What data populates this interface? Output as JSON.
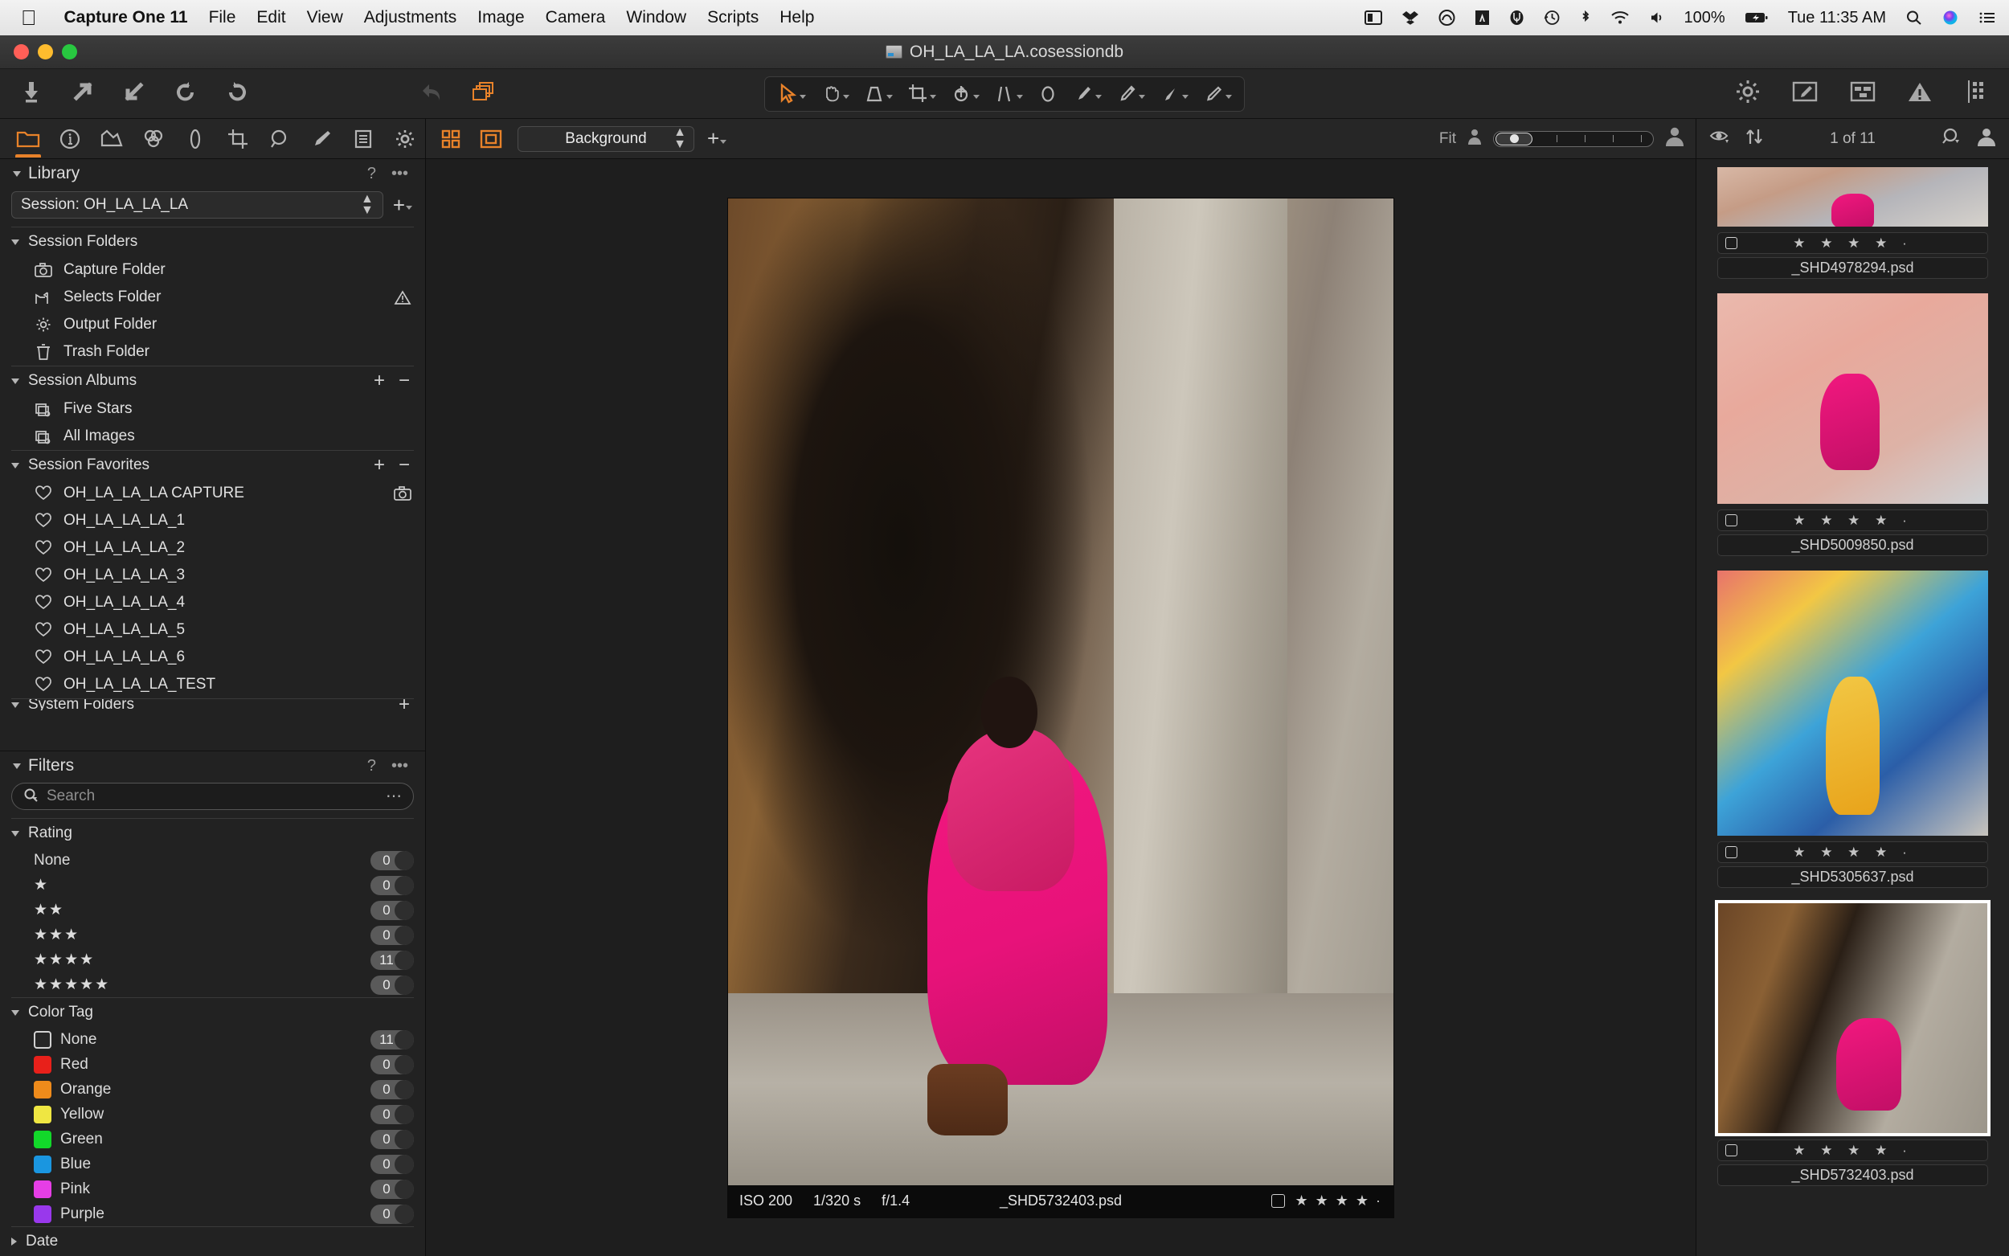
{
  "menubar": {
    "apple": "",
    "app_name": "Capture One 11",
    "items": [
      "File",
      "Edit",
      "View",
      "Adjustments",
      "Image",
      "Camera",
      "Window",
      "Scripts",
      "Help"
    ],
    "status": {
      "icons": [
        "display-icon",
        "dropbox-icon",
        "creative-cloud-icon",
        "adobe-icon",
        "app-icon",
        "time-machine-icon",
        "bluetooth-icon",
        "wifi-icon",
        "volume-icon"
      ],
      "battery_percent": "100%",
      "battery_icon": "battery-charging-icon",
      "clock": "Tue 11:35 AM",
      "spotlight_icon": "search-icon",
      "siri_icon": "siri-icon",
      "notification_icon": "notification-center-icon"
    }
  },
  "window": {
    "title": "OH_LA_LA_LA.cosessiondb",
    "traffic_lights": [
      "close",
      "minimize",
      "zoom"
    ]
  },
  "toolbar": {
    "left_tools": [
      "import-images-icon",
      "export-arrow-icon",
      "import-arrow-icon",
      "rotate-left-icon",
      "rotate-right-icon"
    ],
    "undo_icon": "undo-icon",
    "copy_apply_icon": "copy-apply-adjustments-icon",
    "center_tools": [
      "select-cursor-icon",
      "pan-hand-icon",
      "keystone-icon",
      "crop-icon",
      "rotate-icon",
      "straighten-lines-icon",
      "spot-removal-icon",
      "draw-mask-brush-icon",
      "eyedropper-icon",
      "gradient-mask-icon",
      "heal-brush-icon"
    ],
    "right_tools": [
      "gear-icon",
      "edit-pencil-icon",
      "layout-icon",
      "warning-icon",
      "grid-icon"
    ]
  },
  "tool_tabs": [
    {
      "name": "library-tab",
      "icon": "folder-icon",
      "active": true
    },
    {
      "name": "info-tab",
      "icon": "info-icon",
      "active": false
    },
    {
      "name": "lens-tab",
      "icon": "lens-correction-icon",
      "active": false
    },
    {
      "name": "color-tab",
      "icon": "color-circles-icon",
      "active": false
    },
    {
      "name": "exposure-tab",
      "icon": "exposure-icon",
      "active": false
    },
    {
      "name": "composition-tab",
      "icon": "crop-icon",
      "active": false
    },
    {
      "name": "details-tab",
      "icon": "magnifier-icon",
      "active": false
    },
    {
      "name": "adjustments-tab",
      "icon": "brush-icon",
      "active": false
    },
    {
      "name": "metadata-tab",
      "icon": "document-icon",
      "active": false
    },
    {
      "name": "output-tab",
      "icon": "gear-icon",
      "active": false
    }
  ],
  "library": {
    "title": "Library",
    "help_label": "?",
    "menu_label": "•••",
    "session_value": "Session: OH_LA_LA_LA",
    "session_folders": {
      "label": "Session Folders",
      "items": [
        {
          "label": "Capture Folder",
          "icon": "camera-icon",
          "warning": false
        },
        {
          "label": "Selects Folder",
          "icon": "selects-icon",
          "warning": true
        },
        {
          "label": "Output Folder",
          "icon": "gear-icon",
          "warning": false
        },
        {
          "label": "Trash Folder",
          "icon": "trash-icon",
          "warning": false
        }
      ]
    },
    "session_albums": {
      "label": "Session Albums",
      "add_label": "+",
      "remove_label": "−",
      "items": [
        {
          "label": "Five Stars",
          "icon": "album-icon"
        },
        {
          "label": "All Images",
          "icon": "album-icon"
        }
      ]
    },
    "session_favorites": {
      "label": "Session Favorites",
      "add_label": "+",
      "remove_label": "−",
      "items": [
        {
          "label": "OH_LA_LA_LA CAPTURE",
          "icon": "heart-icon",
          "capture": true
        },
        {
          "label": "OH_LA_LA_LA_1",
          "icon": "heart-icon",
          "capture": false
        },
        {
          "label": "OH_LA_LA_LA_2",
          "icon": "heart-icon",
          "capture": false
        },
        {
          "label": "OH_LA_LA_LA_3",
          "icon": "heart-icon",
          "capture": false
        },
        {
          "label": "OH_LA_LA_LA_4",
          "icon": "heart-icon",
          "capture": false
        },
        {
          "label": "OH_LA_LA_LA_5",
          "icon": "heart-icon",
          "capture": false
        },
        {
          "label": "OH_LA_LA_LA_6",
          "icon": "heart-icon",
          "capture": false
        },
        {
          "label": "OH_LA_LA_LA_TEST",
          "icon": "heart-icon",
          "capture": false
        }
      ]
    },
    "system_folders_label": "System Folders"
  },
  "filters": {
    "title": "Filters",
    "help_label": "?",
    "menu_label": "•••",
    "search_placeholder": "Search",
    "search_value": "",
    "rating": {
      "label": "Rating",
      "items": [
        {
          "label": "None",
          "stars": "",
          "count": "0"
        },
        {
          "label": "",
          "stars": "★",
          "count": "0"
        },
        {
          "label": "",
          "stars": "★★",
          "count": "0"
        },
        {
          "label": "",
          "stars": "★★★",
          "count": "0"
        },
        {
          "label": "",
          "stars": "★★★★",
          "count": "11"
        },
        {
          "label": "",
          "stars": "★★★★★",
          "count": "0"
        }
      ]
    },
    "color_tag": {
      "label": "Color Tag",
      "items": [
        {
          "label": "None",
          "color": "none",
          "count": "11"
        },
        {
          "label": "Red",
          "color": "#e8201a",
          "count": "0"
        },
        {
          "label": "Orange",
          "color": "#ef8b1b",
          "count": "0"
        },
        {
          "label": "Yellow",
          "color": "#efe642",
          "count": "0"
        },
        {
          "label": "Green",
          "color": "#12d82a",
          "count": "0"
        },
        {
          "label": "Blue",
          "color": "#1a96e0",
          "count": "0"
        },
        {
          "label": "Pink",
          "color": "#e63ee6",
          "count": "0"
        },
        {
          "label": "Purple",
          "color": "#9938ec",
          "count": "0"
        }
      ]
    },
    "date": {
      "label": "Date",
      "collapsed": true
    }
  },
  "viewer": {
    "grid_view_icon": "grid-view-icon",
    "single_view_icon": "single-view-icon",
    "background_select": "Background",
    "add_label": "+",
    "fit_label": "Fit",
    "proof_small_icon": "person-small-icon",
    "proof_large_icon": "person-large-icon",
    "image_info": {
      "iso": "ISO 200",
      "shutter": "1/320 s",
      "aperture": "f/1.4",
      "filename": "_SHD5732403.psd",
      "rating": "★ ★ ★ ★ ·"
    }
  },
  "browser": {
    "eye_icon": "visibility-eye-icon",
    "sort_icon": "sort-arrows-icon",
    "count_label": "1 of 11",
    "search_icon": "search-icon",
    "person_icon": "person-icon",
    "thumbnails": [
      {
        "filename": "_SHD4978294.psd",
        "rating": "★ ★ ★ ★ ·",
        "selected": false,
        "art": "t1",
        "partial_top": true
      },
      {
        "filename": "_SHD5009850.psd",
        "rating": "★ ★ ★ ★ ·",
        "selected": false,
        "art": "t2",
        "partial_top": false
      },
      {
        "filename": "_SHD5305637.psd",
        "rating": "★ ★ ★ ★ ·",
        "selected": false,
        "art": "t3",
        "partial_top": false
      },
      {
        "filename": "_SHD5732403.psd",
        "rating": "★ ★ ★ ★ ·",
        "selected": true,
        "art": "t4",
        "partial_top": false
      }
    ]
  }
}
